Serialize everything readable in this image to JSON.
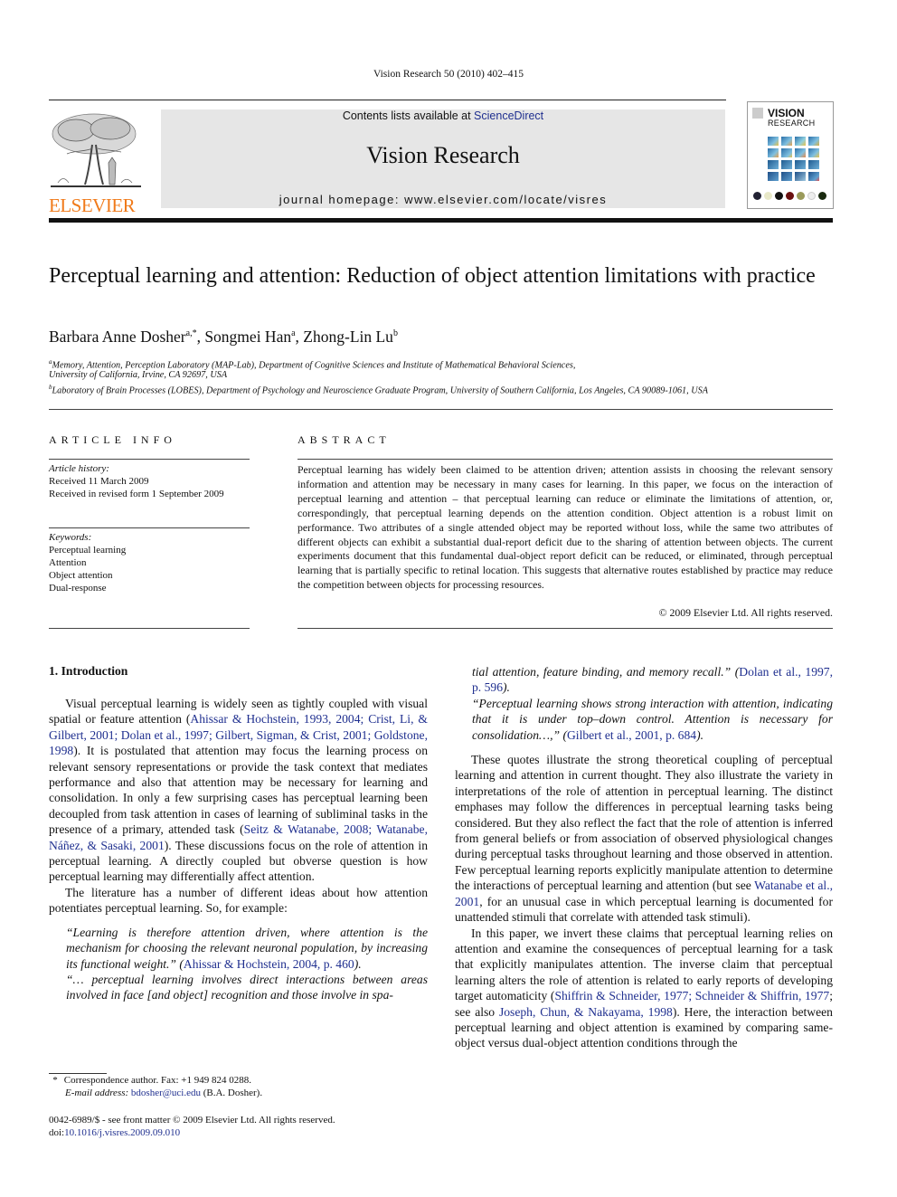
{
  "running_head": "Vision Research 50 (2010) 402–415",
  "publisher": {
    "name": "ELSEVIER",
    "color": "#f07a1a"
  },
  "banner": {
    "contents_prefix": "Contents lists available at ",
    "contents_link": "ScienceDirect",
    "journal_title": "Vision Research",
    "homepage": "journal homepage: www.elsevier.com/locate/visres"
  },
  "cover": {
    "title_line1": "VISION",
    "title_line2": "RESEARCH"
  },
  "article": {
    "title": "Perceptual learning and attention: Reduction of object attention limitations with practice",
    "authors": [
      {
        "name": "Barbara Anne Dosher",
        "sup": "a,*"
      },
      {
        "name": "Songmei Han",
        "sup": "a"
      },
      {
        "name": "Zhong-Lin Lu",
        "sup": "b"
      }
    ],
    "affiliations": [
      {
        "mark": "a",
        "line1": "Memory, Attention, Perception Laboratory (MAP-Lab), Department of Cognitive Sciences and Institute of Mathematical Behavioral Sciences,",
        "line2": "University of California, Irvine, CA 92697, USA"
      },
      {
        "mark": "b",
        "line1": "Laboratory of Brain Processes (LOBES), Department of Psychology and Neuroscience Graduate Program, University of Southern California, Los Angeles, CA 90089-1061, USA"
      }
    ]
  },
  "article_info": {
    "heading": "ARTICLE INFO",
    "history_label": "Article history:",
    "received": "Received 11 March 2009",
    "revised": "Received in revised form 1 September 2009",
    "keywords_label": "Keywords:",
    "keywords": [
      "Perceptual learning",
      "Attention",
      "Object attention",
      "Dual-response"
    ]
  },
  "abstract": {
    "heading": "ABSTRACT",
    "text": "Perceptual learning has widely been claimed to be attention driven; attention assists in choosing the relevant sensory information and attention may be necessary in many cases for learning. In this paper, we focus on the interaction of perceptual learning and attention – that perceptual learning can reduce or eliminate the limitations of attention, or, correspondingly, that perceptual learning depends on the attention condition. Object attention is a robust limit on performance. Two attributes of a single attended object may be reported without loss, while the same two attributes of different objects can exhibit a substantial dual-report deficit due to the sharing of attention between objects. The current experiments document that this fundamental dual-object report deficit can be reduced, or eliminated, through perceptual learning that is partially specific to retinal location. This suggests that alternative routes established by practice may reduce the competition between objects for processing resources.",
    "copyright": "© 2009 Elsevier Ltd. All rights reserved."
  },
  "intro": {
    "heading": "1. Introduction",
    "p1": [
      {
        "t": "Visual perceptual learning is widely seen as tightly coupled with visual spatial or feature attention ("
      },
      {
        "l": "Ahissar & Hochstein, 1993, 2004; Crist, Li, & Gilbert, 2001; Dolan et al., 1997; Gilbert, Sigman, & Crist, 2001; Goldstone, 1998"
      },
      {
        "t": "). It is postulated that attention may focus the learning process on relevant sensory representations or provide the task context that mediates performance and also that attention may be necessary for learning and consolidation. In only a few surprising cases has perceptual learning been decoupled from task attention in cases of learning of subliminal tasks in the presence of a primary, attended task ("
      },
      {
        "l": "Seitz & Watanabe, 2008; Watanabe, Náñez, & Sasaki, 2001"
      },
      {
        "t": "). These discussions focus on the role of attention in perceptual learning. A directly coupled but obverse question is how perceptual learning may differentially affect attention."
      }
    ],
    "p2": "The literature has a number of different ideas about how attention potentiates perceptual learning. So, for example:",
    "quote1": {
      "text": "“Learning is therefore attention driven, where attention is the mechanism for choosing the relevant neuronal population, by increasing its functional weight.” ",
      "cite": "Ahissar & Hochstein, 2004, p. 460"
    },
    "quote2_left": "“… perceptual learning involves direct interactions between areas involved in face [and object] recognition and those involve in spa-",
    "quote2_right": {
      "text": "tial attention, feature binding, and memory recall.” ",
      "cite": "Dolan et al., 1997, p. 596"
    },
    "quote3": {
      "text": "“Perceptual learning shows strong interaction with attention, indicating that it is under top–down control. Attention is necessary for consolidation…,” ",
      "cite": "Gilbert et al., 2001, p. 684"
    },
    "p3": [
      {
        "t": "These quotes illustrate the strong theoretical coupling of perceptual learning and attention in current thought. They also illustrate the variety in interpretations of the role of attention in perceptual learning. The distinct emphases may follow the differences in perceptual learning tasks being considered. But they also reflect the fact that the role of attention is inferred from general beliefs or from association of observed physiological changes during perceptual tasks throughout learning and those observed in attention. Few perceptual learning reports explicitly manipulate attention to determine the interactions of perceptual learning and attention (but see "
      },
      {
        "l": "Watanabe et al., 2001"
      },
      {
        "t": ", for an unusual case in which perceptual learning is documented for unattended stimuli that correlate with attended task stimuli)."
      }
    ],
    "p4": [
      {
        "t": "In this paper, we invert these claims that perceptual learning relies on attention and examine the consequences of perceptual learning for a task that explicitly manipulates attention. The inverse claim that perceptual learning alters the role of attention is related to early reports of developing target automaticity ("
      },
      {
        "l": "Shiffrin & Schneider, 1977; Schneider & Shiffrin, 1977"
      },
      {
        "t": "; see also "
      },
      {
        "l": "Joseph, Chun, & Nakayama, 1998"
      },
      {
        "t": "). Here, the interaction between perceptual learning and object attention is examined by comparing same-object versus dual-object attention conditions through the"
      }
    ]
  },
  "footnote": {
    "mark": "*",
    "correspondence": "Correspondence author. Fax: +1 949 824 0288.",
    "email_label": "E-mail address: ",
    "email": "bdosher@uci.edu",
    "email_suffix": " (B.A. Dosher)."
  },
  "bottom": {
    "issn_line": "0042-6989/$ - see front matter © 2009 Elsevier Ltd. All rights reserved.",
    "doi_prefix": "doi:",
    "doi": "10.1016/j.visres.2009.09.010"
  }
}
